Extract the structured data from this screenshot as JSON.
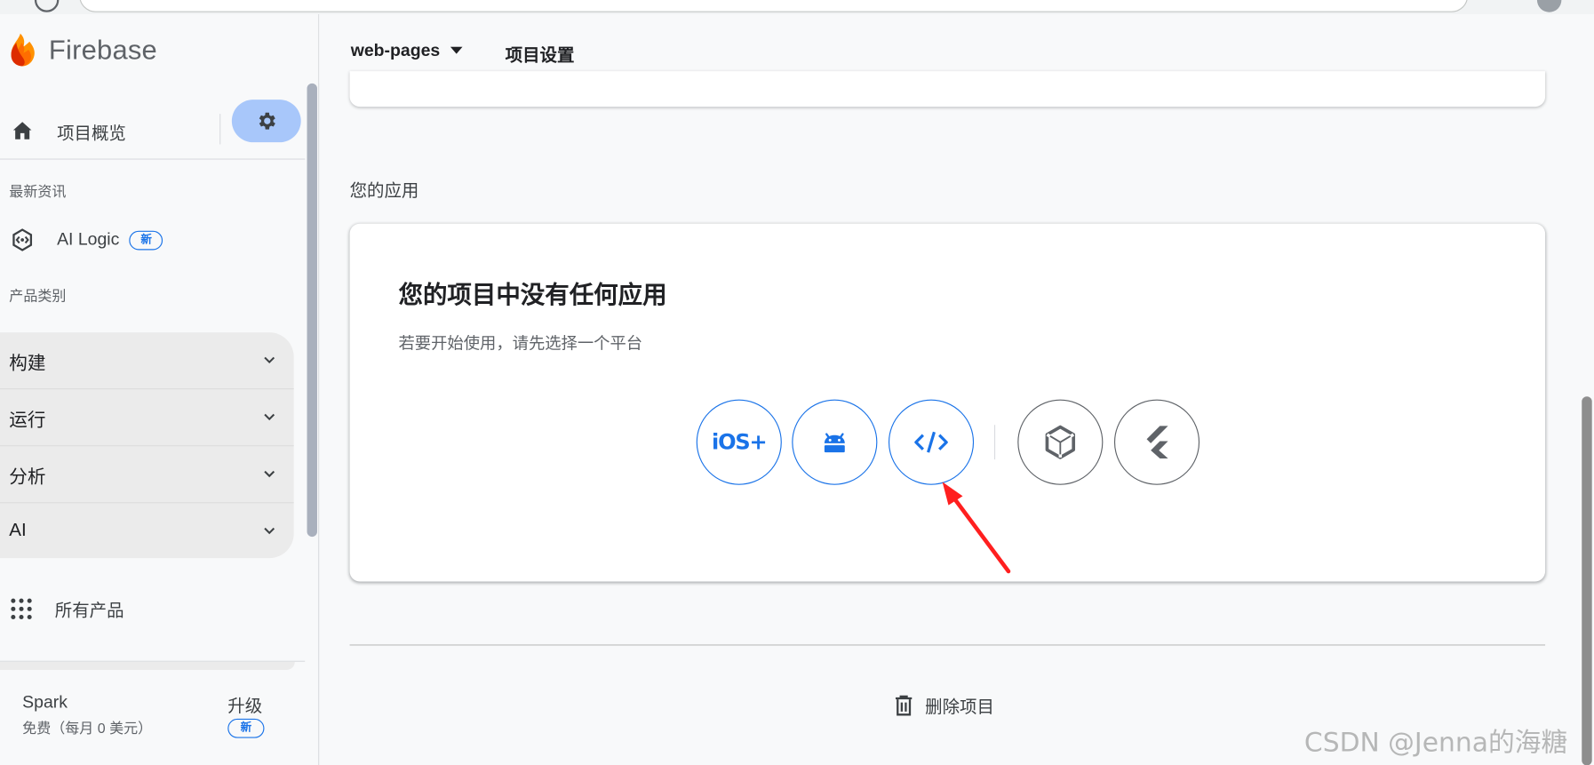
{
  "app": {
    "brand": "Firebase",
    "project_name": "web-pages",
    "header_title": "项目设置"
  },
  "sidebar": {
    "overview_label": "项目概览",
    "news_section": "最新资讯",
    "ai_logic_label": "AI Logic",
    "ai_logic_badge": "新",
    "categories_section": "产品类别",
    "categories": [
      {
        "label": "构建"
      },
      {
        "label": "运行"
      },
      {
        "label": "分析"
      },
      {
        "label": "AI"
      }
    ],
    "all_products_label": "所有产品",
    "plan": {
      "name": "Spark",
      "description": "免费（每月 0 美元）",
      "upgrade_label": "升级",
      "upgrade_badge": "新"
    }
  },
  "main": {
    "apps_section_title": "您的应用",
    "empty_title": "您的项目中没有任何应用",
    "empty_desc": "若要开始使用，请先选择一个平台",
    "platforms": [
      {
        "name": "ios",
        "label": "iOS+",
        "icon": "ios-icon"
      },
      {
        "name": "android",
        "icon": "android-icon"
      },
      {
        "name": "web",
        "icon": "code-icon"
      },
      {
        "name": "unity",
        "icon": "unity-icon"
      },
      {
        "name": "flutter",
        "icon": "flutter-icon"
      }
    ],
    "delete_label": "删除项目"
  },
  "watermark": "CSDN @Jenna的海糖",
  "colors": {
    "accent": "#1a73e8",
    "settings_active_bg": "#a8c7fa",
    "annotation_arrow": "#ff1f1f"
  }
}
